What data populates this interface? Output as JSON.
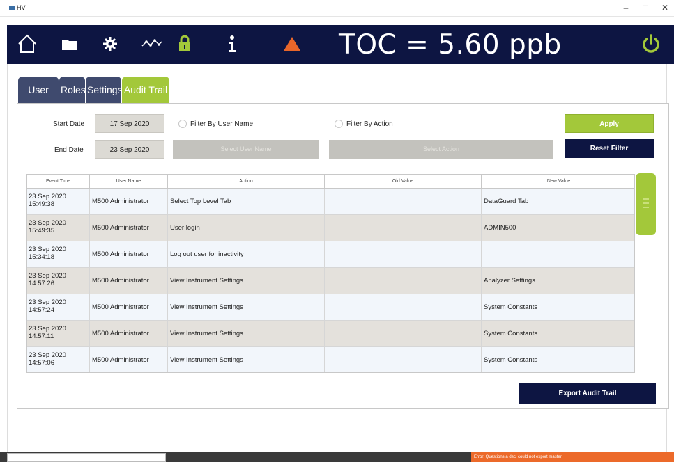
{
  "window": {
    "title": "HV"
  },
  "topbar": {
    "toc_reading": "TOC = 5.60 ppb",
    "icons": [
      "home-icon",
      "folder-icon",
      "gear-icon",
      "trend-icon",
      "lock-icon",
      "info-icon",
      "warning-icon",
      "power-icon"
    ],
    "colors": {
      "bar": "#0d1542",
      "accent": "#a3c83a",
      "warning": "#e8662a"
    }
  },
  "tabs": [
    {
      "label": "User List"
    },
    {
      "label": "Roles"
    },
    {
      "label": "Settings"
    },
    {
      "label": "Audit Trail",
      "active": true
    }
  ],
  "filters": {
    "start_date_label": "Start Date",
    "start_date_value": "17 Sep 2020",
    "end_date_label": "End Date",
    "end_date_value": "23 Sep 2020",
    "filter_user_label": "Filter By User Name",
    "filter_action_label": "Filter By Action",
    "select_user_label": "Select User Name",
    "select_action_label": "Select Action",
    "apply_label": "Apply",
    "reset_label": "Reset Filter"
  },
  "table": {
    "headers": [
      "Event Time",
      "User Name",
      "Action",
      "Old Value",
      "New Value"
    ],
    "rows": [
      {
        "date": "23 Sep 2020",
        "time": "15:49:38",
        "user": "M500 Administrator",
        "action": "Select Top Level Tab",
        "old": "",
        "new": "DataGuard Tab"
      },
      {
        "date": "23 Sep 2020",
        "time": "15:49:35",
        "user": "M500 Administrator",
        "action": "User login",
        "old": "",
        "new": "ADMIN500"
      },
      {
        "date": "23 Sep 2020",
        "time": "15:34:18",
        "user": "M500 Administrator",
        "action": "Log out user for inactivity",
        "old": "",
        "new": ""
      },
      {
        "date": "23 Sep 2020",
        "time": "14:57:26",
        "user": "M500 Administrator",
        "action": "View Instrument Settings",
        "old": "",
        "new": "Analyzer Settings"
      },
      {
        "date": "23 Sep 2020",
        "time": "14:57:24",
        "user": "M500 Administrator",
        "action": "View Instrument Settings",
        "old": "",
        "new": "System Constants"
      },
      {
        "date": "23 Sep 2020",
        "time": "14:57:11",
        "user": "M500 Administrator",
        "action": "View Instrument Settings",
        "old": "",
        "new": "System Constants"
      },
      {
        "date": "23 Sep 2020",
        "time": "14:57:06",
        "user": "M500 Administrator",
        "action": "View Instrument Settings",
        "old": "",
        "new": "System Constants"
      }
    ]
  },
  "export_label": "Export Audit Trail",
  "status_bar": {
    "alert_text": "Error: Questions a deci could not export master"
  }
}
